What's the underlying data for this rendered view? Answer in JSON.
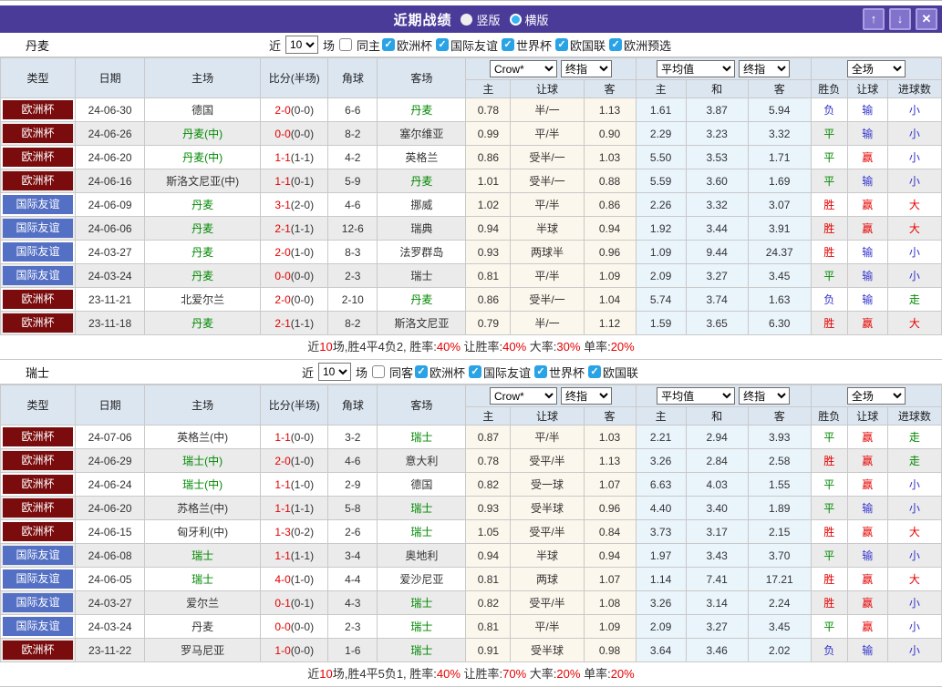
{
  "titlebar": {
    "title": "近期战绩",
    "vertical_label": "竖版",
    "horizontal_label": "横版",
    "up_label": "↑",
    "down_label": "↓",
    "close_label": "✕"
  },
  "filter_labels": {
    "near": "近",
    "matches": "场"
  },
  "table_header": {
    "static_cols": [
      "类型",
      "日期",
      "主场",
      "比分(半场)",
      "角球",
      "客场"
    ],
    "odds_group": {
      "select1": "Crow*",
      "select2": "终指",
      "sub": [
        "主",
        "让球",
        "客"
      ]
    },
    "avg_group": {
      "select1": "平均值",
      "select2": "终指",
      "sub": [
        "主",
        "和",
        "客"
      ]
    },
    "result_group": {
      "select": "全场",
      "sub": [
        "胜负",
        "让球",
        "进球数"
      ]
    }
  },
  "colors": {
    "accent_purple": "#4b3b98",
    "euro_badge": "#7a0c0d",
    "friendly_badge": "#5470c4",
    "win_red": "#e60000",
    "draw_green": "#008800",
    "lose_blue": "#3333cc"
  },
  "sections": [
    {
      "team": "丹麦",
      "count": "10",
      "same_checkbox": {
        "label": "同主",
        "checked": false
      },
      "league_checkboxes": [
        {
          "label": "欧洲杯",
          "checked": true
        },
        {
          "label": "国际友谊",
          "checked": true
        },
        {
          "label": "世界杯",
          "checked": true
        },
        {
          "label": "欧国联",
          "checked": true
        },
        {
          "label": "欧洲预选",
          "checked": true
        }
      ],
      "rows": [
        {
          "type": "欧洲杯",
          "type_style": "maroon",
          "date": "24-06-30",
          "home": "德国",
          "home_green": false,
          "score": "2-0",
          "half": "(0-0)",
          "corners": "6-6",
          "away": "丹麦",
          "away_green": true,
          "odds": [
            "0.78",
            "半/一",
            "1.13"
          ],
          "avg": [
            "1.61",
            "3.87",
            "5.94"
          ],
          "results": [
            "负",
            "输",
            "小"
          ]
        },
        {
          "type": "欧洲杯",
          "type_style": "maroon",
          "date": "24-06-26",
          "home": "丹麦(中)",
          "home_green": true,
          "score": "0-0",
          "half": "(0-0)",
          "corners": "8-2",
          "away": "塞尔维亚",
          "away_green": false,
          "odds": [
            "0.99",
            "平/半",
            "0.90"
          ],
          "avg": [
            "2.29",
            "3.23",
            "3.32"
          ],
          "results": [
            "平",
            "输",
            "小"
          ]
        },
        {
          "type": "欧洲杯",
          "type_style": "maroon",
          "date": "24-06-20",
          "home": "丹麦(中)",
          "home_green": true,
          "score": "1-1",
          "half": "(1-1)",
          "corners": "4-2",
          "away": "英格兰",
          "away_green": false,
          "odds": [
            "0.86",
            "受半/一",
            "1.03"
          ],
          "avg": [
            "5.50",
            "3.53",
            "1.71"
          ],
          "results": [
            "平",
            "赢",
            "小"
          ]
        },
        {
          "type": "欧洲杯",
          "type_style": "maroon",
          "date": "24-06-16",
          "home": "斯洛文尼亚(中)",
          "home_green": false,
          "score": "1-1",
          "half": "(0-1)",
          "corners": "5-9",
          "away": "丹麦",
          "away_green": true,
          "odds": [
            "1.01",
            "受半/一",
            "0.88"
          ],
          "avg": [
            "5.59",
            "3.60",
            "1.69"
          ],
          "results": [
            "平",
            "输",
            "小"
          ]
        },
        {
          "type": "国际友谊",
          "type_style": "blue",
          "date": "24-06-09",
          "home": "丹麦",
          "home_green": true,
          "score": "3-1",
          "half": "(2-0)",
          "corners": "4-6",
          "away": "挪威",
          "away_green": false,
          "odds": [
            "1.02",
            "平/半",
            "0.86"
          ],
          "avg": [
            "2.26",
            "3.32",
            "3.07"
          ],
          "results": [
            "胜",
            "赢",
            "大"
          ]
        },
        {
          "type": "国际友谊",
          "type_style": "blue",
          "date": "24-06-06",
          "home": "丹麦",
          "home_green": true,
          "score": "2-1",
          "half": "(1-1)",
          "corners": "12-6",
          "away": "瑞典",
          "away_green": false,
          "odds": [
            "0.94",
            "半球",
            "0.94"
          ],
          "avg": [
            "1.92",
            "3.44",
            "3.91"
          ],
          "results": [
            "胜",
            "赢",
            "大"
          ]
        },
        {
          "type": "国际友谊",
          "type_style": "blue",
          "date": "24-03-27",
          "home": "丹麦",
          "home_green": true,
          "score": "2-0",
          "half": "(1-0)",
          "corners": "8-3",
          "away": "法罗群岛",
          "away_green": false,
          "odds": [
            "0.93",
            "两球半",
            "0.96"
          ],
          "avg": [
            "1.09",
            "9.44",
            "24.37"
          ],
          "results": [
            "胜",
            "输",
            "小"
          ]
        },
        {
          "type": "国际友谊",
          "type_style": "blue",
          "date": "24-03-24",
          "home": "丹麦",
          "home_green": true,
          "score": "0-0",
          "half": "(0-0)",
          "corners": "2-3",
          "away": "瑞士",
          "away_green": false,
          "odds": [
            "0.81",
            "平/半",
            "1.09"
          ],
          "avg": [
            "2.09",
            "3.27",
            "3.45"
          ],
          "results": [
            "平",
            "输",
            "小"
          ]
        },
        {
          "type": "欧洲杯",
          "type_style": "maroon",
          "date": "23-11-21",
          "home": "北爱尔兰",
          "home_green": false,
          "score": "2-0",
          "half": "(0-0)",
          "corners": "2-10",
          "away": "丹麦",
          "away_green": true,
          "odds": [
            "0.86",
            "受半/一",
            "1.04"
          ],
          "avg": [
            "5.74",
            "3.74",
            "1.63"
          ],
          "results": [
            "负",
            "输",
            "走"
          ]
        },
        {
          "type": "欧洲杯",
          "type_style": "maroon",
          "date": "23-11-18",
          "home": "丹麦",
          "home_green": true,
          "score": "2-1",
          "half": "(1-1)",
          "corners": "8-2",
          "away": "斯洛文尼亚",
          "away_green": false,
          "odds": [
            "0.79",
            "半/一",
            "1.12"
          ],
          "avg": [
            "1.59",
            "3.65",
            "6.30"
          ],
          "results": [
            "胜",
            "赢",
            "大"
          ]
        }
      ],
      "summary": [
        {
          "text": "近",
          "red": false
        },
        {
          "text": "10",
          "red": true
        },
        {
          "text": "场,胜4平4负2, 胜率:",
          "red": false
        },
        {
          "text": "40%",
          "red": true
        },
        {
          "text": " 让胜率:",
          "red": false
        },
        {
          "text": "40%",
          "red": true
        },
        {
          "text": " 大率:",
          "red": false
        },
        {
          "text": "30%",
          "red": true
        },
        {
          "text": " 单率:",
          "red": false
        },
        {
          "text": "20%",
          "red": true
        }
      ]
    },
    {
      "team": "瑞士",
      "count": "10",
      "same_checkbox": {
        "label": "同客",
        "checked": false
      },
      "league_checkboxes": [
        {
          "label": "欧洲杯",
          "checked": true
        },
        {
          "label": "国际友谊",
          "checked": true
        },
        {
          "label": "世界杯",
          "checked": true
        },
        {
          "label": "欧国联",
          "checked": true
        }
      ],
      "rows": [
        {
          "type": "欧洲杯",
          "type_style": "maroon",
          "date": "24-07-06",
          "home": "英格兰(中)",
          "home_green": false,
          "score": "1-1",
          "half": "(0-0)",
          "corners": "3-2",
          "away": "瑞士",
          "away_green": true,
          "odds": [
            "0.87",
            "平/半",
            "1.03"
          ],
          "avg": [
            "2.21",
            "2.94",
            "3.93"
          ],
          "results": [
            "平",
            "赢",
            "走"
          ]
        },
        {
          "type": "欧洲杯",
          "type_style": "maroon",
          "date": "24-06-29",
          "home": "瑞士(中)",
          "home_green": true,
          "score": "2-0",
          "half": "(1-0)",
          "corners": "4-6",
          "away": "意大利",
          "away_green": false,
          "odds": [
            "0.78",
            "受平/半",
            "1.13"
          ],
          "avg": [
            "3.26",
            "2.84",
            "2.58"
          ],
          "results": [
            "胜",
            "赢",
            "走"
          ]
        },
        {
          "type": "欧洲杯",
          "type_style": "maroon",
          "date": "24-06-24",
          "home": "瑞士(中)",
          "home_green": true,
          "score": "1-1",
          "half": "(1-0)",
          "corners": "2-9",
          "away": "德国",
          "away_green": false,
          "odds": [
            "0.82",
            "受一球",
            "1.07"
          ],
          "avg": [
            "6.63",
            "4.03",
            "1.55"
          ],
          "results": [
            "平",
            "赢",
            "小"
          ]
        },
        {
          "type": "欧洲杯",
          "type_style": "maroon",
          "date": "24-06-20",
          "home": "苏格兰(中)",
          "home_green": false,
          "score": "1-1",
          "half": "(1-1)",
          "corners": "5-8",
          "away": "瑞士",
          "away_green": true,
          "odds": [
            "0.93",
            "受半球",
            "0.96"
          ],
          "avg": [
            "4.40",
            "3.40",
            "1.89"
          ],
          "results": [
            "平",
            "输",
            "小"
          ]
        },
        {
          "type": "欧洲杯",
          "type_style": "maroon",
          "date": "24-06-15",
          "home": "匈牙利(中)",
          "home_green": false,
          "score": "1-3",
          "half": "(0-2)",
          "corners": "2-6",
          "away": "瑞士",
          "away_green": true,
          "odds": [
            "1.05",
            "受平/半",
            "0.84"
          ],
          "avg": [
            "3.73",
            "3.17",
            "2.15"
          ],
          "results": [
            "胜",
            "赢",
            "大"
          ]
        },
        {
          "type": "国际友谊",
          "type_style": "blue",
          "date": "24-06-08",
          "home": "瑞士",
          "home_green": true,
          "score": "1-1",
          "half": "(1-1)",
          "corners": "3-4",
          "away": "奥地利",
          "away_green": false,
          "odds": [
            "0.94",
            "半球",
            "0.94"
          ],
          "avg": [
            "1.97",
            "3.43",
            "3.70"
          ],
          "results": [
            "平",
            "输",
            "小"
          ]
        },
        {
          "type": "国际友谊",
          "type_style": "blue",
          "date": "24-06-05",
          "home": "瑞士",
          "home_green": true,
          "score": "4-0",
          "half": "(1-0)",
          "corners": "4-4",
          "away": "爱沙尼亚",
          "away_green": false,
          "odds": [
            "0.81",
            "两球",
            "1.07"
          ],
          "avg": [
            "1.14",
            "7.41",
            "17.21"
          ],
          "results": [
            "胜",
            "赢",
            "大"
          ]
        },
        {
          "type": "国际友谊",
          "type_style": "blue",
          "date": "24-03-27",
          "home": "爱尔兰",
          "home_green": false,
          "score": "0-1",
          "half": "(0-1)",
          "corners": "4-3",
          "away": "瑞士",
          "away_green": true,
          "odds": [
            "0.82",
            "受平/半",
            "1.08"
          ],
          "avg": [
            "3.26",
            "3.14",
            "2.24"
          ],
          "results": [
            "胜",
            "赢",
            "小"
          ]
        },
        {
          "type": "国际友谊",
          "type_style": "blue",
          "date": "24-03-24",
          "home": "丹麦",
          "home_green": false,
          "score": "0-0",
          "half": "(0-0)",
          "corners": "2-3",
          "away": "瑞士",
          "away_green": true,
          "odds": [
            "0.81",
            "平/半",
            "1.09"
          ],
          "avg": [
            "2.09",
            "3.27",
            "3.45"
          ],
          "results": [
            "平",
            "赢",
            "小"
          ]
        },
        {
          "type": "欧洲杯",
          "type_style": "maroon",
          "date": "23-11-22",
          "home": "罗马尼亚",
          "home_green": false,
          "score": "1-0",
          "half": "(0-0)",
          "corners": "1-6",
          "away": "瑞士",
          "away_green": true,
          "odds": [
            "0.91",
            "受半球",
            "0.98"
          ],
          "avg": [
            "3.64",
            "3.46",
            "2.02"
          ],
          "results": [
            "负",
            "输",
            "小"
          ]
        }
      ],
      "summary": [
        {
          "text": "近",
          "red": false
        },
        {
          "text": "10",
          "red": true
        },
        {
          "text": "场,胜4平5负1, 胜率:",
          "red": false
        },
        {
          "text": "40%",
          "red": true
        },
        {
          "text": " 让胜率:",
          "red": false
        },
        {
          "text": "70%",
          "red": true
        },
        {
          "text": " 大率:",
          "red": false
        },
        {
          "text": "20%",
          "red": true
        },
        {
          "text": " 单率:",
          "red": false
        },
        {
          "text": "20%",
          "red": true
        }
      ]
    }
  ]
}
